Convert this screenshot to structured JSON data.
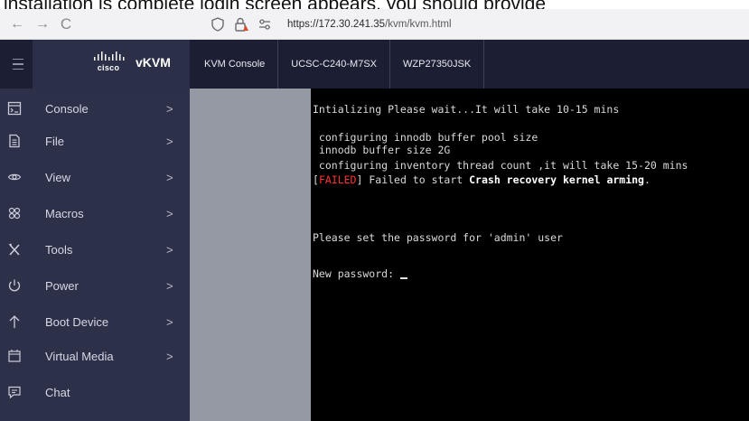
{
  "caption": "installation is complete login screen appears, you should provide",
  "browser": {
    "back": "←",
    "forward": "→",
    "reload": "C",
    "url_host": "https://172.30.241.35",
    "url_path": "/kvm/kvm.html"
  },
  "header": {
    "brand_logo_text": "cisco",
    "app_name": "vKVM",
    "tabs": [
      "KVM Console",
      "UCSC-C240-M7SX",
      "WZP27350JSK"
    ]
  },
  "sidebar": {
    "items": [
      {
        "label": "Console",
        "icon": "console-icon",
        "chevron": ">"
      },
      {
        "label": "File",
        "icon": "file-icon",
        "chevron": ">"
      },
      {
        "label": "View",
        "icon": "eye-icon",
        "chevron": ">"
      },
      {
        "label": "Macros",
        "icon": "macros-icon",
        "chevron": ">"
      },
      {
        "label": "Tools",
        "icon": "tools-icon",
        "chevron": ">"
      },
      {
        "label": "Power",
        "icon": "power-icon",
        "chevron": ">"
      },
      {
        "label": "Boot Device",
        "icon": "arrow-up-icon",
        "chevron": ">"
      },
      {
        "label": "Virtual Media",
        "icon": "virtual-media-icon",
        "chevron": ">"
      },
      {
        "label": "Chat",
        "icon": "chat-icon",
        "chevron": ""
      }
    ]
  },
  "console": {
    "line1": "Intializing Please wait...It will take 10-15 mins",
    "line2": " configuring innodb buffer pool size",
    "line3": " innodb buffer size 2G",
    "line4": " configuring inventory thread count ,it will take 15-20 mins",
    "line5_bracket_open": "[",
    "line5_failed": "FAILED",
    "line5_bracket_close": "]",
    "line5_text": " Failed to start ",
    "line5_bold": "Crash recovery kernel arming",
    "line5_end": ".",
    "line6": "Please set the password for 'admin' user",
    "line7": "New password: "
  },
  "colors": {
    "header_bg": "#1c1f34",
    "sidebar_bg": "#2c3049",
    "failed": "#ff3030"
  }
}
